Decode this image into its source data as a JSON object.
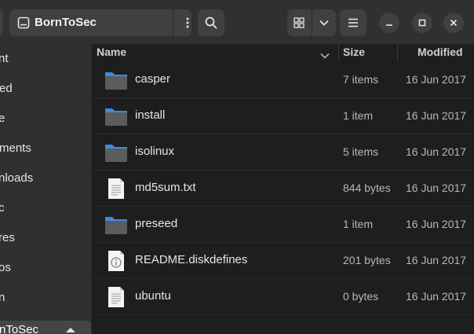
{
  "header": {
    "location_label": "BornToSec"
  },
  "sidebar": {
    "items": [
      {
        "label": "nt"
      },
      {
        "label": "ed"
      },
      {
        "label": "e"
      },
      {
        "label": "ments"
      },
      {
        "label": "nloads"
      },
      {
        "label": "c"
      },
      {
        "label": "res"
      },
      {
        "label": "os"
      },
      {
        "label": "n"
      }
    ],
    "active_item": {
      "label": "nToSec"
    }
  },
  "columns": {
    "name": "Name",
    "size": "Size",
    "modified": "Modified"
  },
  "files": [
    {
      "name": "casper",
      "size": "7 items",
      "modified": "16 Jun 2017",
      "type": "folder"
    },
    {
      "name": "install",
      "size": "1 item",
      "modified": "16 Jun 2017",
      "type": "folder"
    },
    {
      "name": "isolinux",
      "size": "5 items",
      "modified": "16 Jun 2017",
      "type": "folder"
    },
    {
      "name": "md5sum.txt",
      "size": "844 bytes",
      "modified": "16 Jun 2017",
      "type": "text"
    },
    {
      "name": "preseed",
      "size": "1 item",
      "modified": "16 Jun 2017",
      "type": "folder"
    },
    {
      "name": "README.diskdefines",
      "size": "201 bytes",
      "modified": "16 Jun 2017",
      "type": "info"
    },
    {
      "name": "ubuntu",
      "size": "0 bytes",
      "modified": "16 Jun 2017",
      "type": "text"
    }
  ],
  "colors": {
    "folder_blue": "#3d8be0",
    "folder_gray": "#5c5c5c",
    "background": "#1e1e1e",
    "headerbar": "#303030"
  }
}
